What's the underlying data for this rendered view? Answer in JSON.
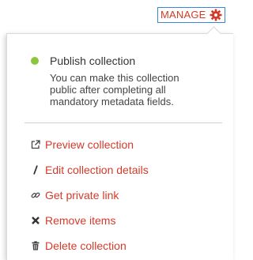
{
  "manage": {
    "label": "MANAGE",
    "icon": "gear-icon",
    "color": "#d23b2b",
    "border_color": "#3a86d6"
  },
  "publish": {
    "status_color": "#8cc63f",
    "title": "Publish collection",
    "description": "You can make this collection public after completing all mandatory metadata fields."
  },
  "menu": {
    "items": [
      {
        "label": "Preview collection",
        "icon": "external-link-icon"
      },
      {
        "label": "Edit collection details",
        "icon": "pencil-icon"
      },
      {
        "label": "Get private link",
        "icon": "link-icon"
      },
      {
        "label": "Remove items",
        "icon": "x-icon"
      },
      {
        "label": "Delete collection",
        "icon": "trash-icon"
      }
    ]
  }
}
